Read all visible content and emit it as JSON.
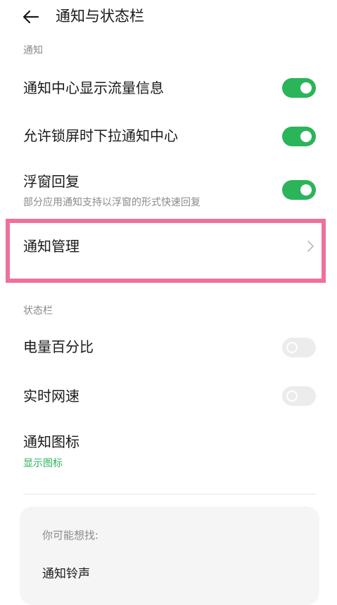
{
  "header": {
    "back_icon": "arrow-left-icon",
    "title": "通知与状态栏"
  },
  "sections": {
    "notifications": {
      "header": "通知",
      "items": [
        {
          "title": "通知中心显示流量信息",
          "toggle": "on"
        },
        {
          "title": "允许锁屏时下拉通知中心",
          "toggle": "on"
        },
        {
          "title": "浮窗回复",
          "subtitle": "部分应用通知支持以浮窗的形式快速回复",
          "toggle": "on"
        },
        {
          "title": "通知管理",
          "icon": "chevron-right-icon"
        }
      ]
    },
    "status_bar": {
      "header": "状态栏",
      "items": [
        {
          "title": "电量百分比",
          "toggle": "off"
        },
        {
          "title": "实时网速",
          "toggle": "off"
        },
        {
          "title": "通知图标",
          "subtitle": "显示图标"
        }
      ]
    }
  },
  "suggestions": {
    "heading": "你可能想找:",
    "items": [
      "通知铃声"
    ]
  },
  "colors": {
    "accent": "#2bb45a",
    "highlight": "#f07099",
    "toggle_off": "#ececec"
  }
}
